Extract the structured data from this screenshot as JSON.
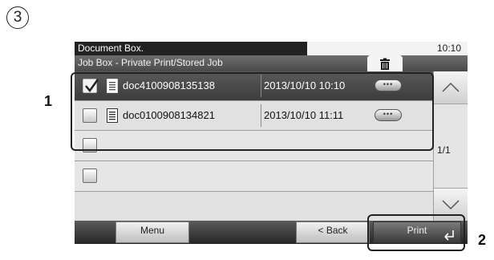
{
  "step_number": "3",
  "header": {
    "title": "Document Box.",
    "time": "10:10",
    "subtitle": "Job Box - Private Print/Stored Job",
    "delete_icon": "trash-icon"
  },
  "rows": [
    {
      "checked": true,
      "selected": true,
      "icon": "document-icon",
      "name": "doc4100908135138",
      "date": "2013/10/10 10:10",
      "detail_icon": "more-details-icon"
    },
    {
      "checked": false,
      "selected": false,
      "icon": "document-icon",
      "name": "doc0100908134821",
      "date": "2013/10/10 11:11",
      "detail_icon": "more-details-icon"
    },
    {
      "checked": false,
      "selected": false,
      "name": "",
      "date": ""
    },
    {
      "checked": false,
      "selected": false,
      "name": "",
      "date": ""
    }
  ],
  "scroll": {
    "up_icon": "chevron-up-icon",
    "down_icon": "chevron-down-icon",
    "page": "1/1"
  },
  "footer": {
    "menu_label": "Menu",
    "back_label": "< Back",
    "print_label": "Print",
    "enter_icon": "enter-arrow-icon"
  },
  "callouts": {
    "one": "1",
    "two": "2"
  },
  "colors": {
    "selected_row": "#4a4a4a",
    "list_background": "#e1e1e1",
    "bottom_bar": "#3a3a3a"
  }
}
